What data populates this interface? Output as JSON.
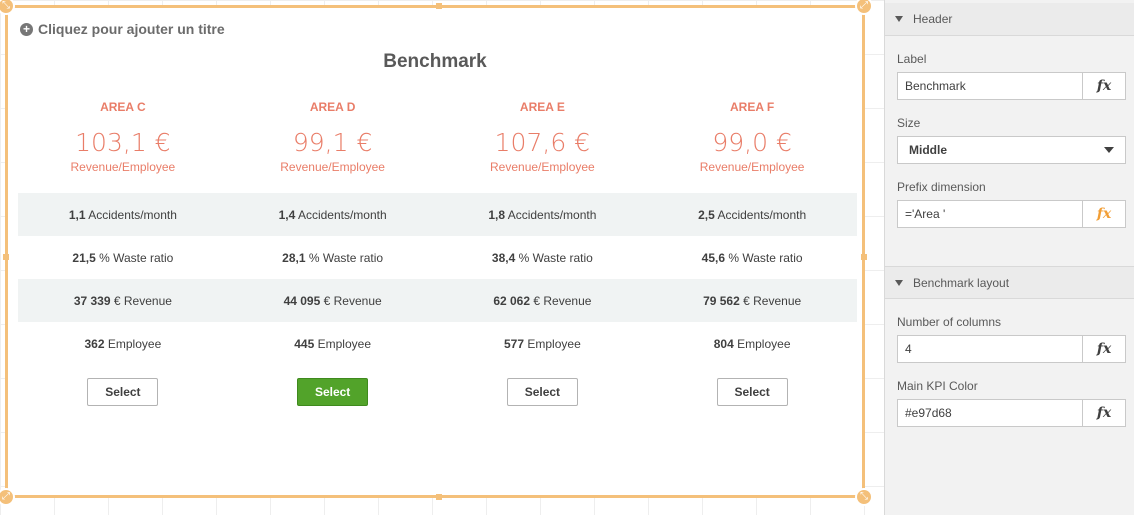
{
  "object": {
    "add_title": "Cliquez pour ajouter un titre",
    "benchmark_title": "Benchmark",
    "main_kpi_label": "Revenue/Employee",
    "areas": [
      {
        "name": "AREA C",
        "main_value": "103,1 €",
        "button": "Select",
        "selected": false
      },
      {
        "name": "AREA D",
        "main_value": "99,1 €",
        "button": "Select",
        "selected": true
      },
      {
        "name": "AREA E",
        "main_value": "107,6 €",
        "button": "Select",
        "selected": false
      },
      {
        "name": "AREA F",
        "main_value": "99,0 €",
        "button": "Select",
        "selected": false
      }
    ],
    "kpi_rows": [
      {
        "label": "Accidents/month",
        "values": [
          "1,1",
          "1,4",
          "1,8",
          "2,5"
        ]
      },
      {
        "label": "% Waste ratio",
        "values": [
          "21,5",
          "28,1",
          "38,4",
          "45,6"
        ]
      },
      {
        "label": "€ Revenue",
        "values": [
          "37 339",
          "44 095",
          "62 062",
          "79 562"
        ]
      },
      {
        "label": "Employee",
        "values": [
          "362",
          "445",
          "577",
          "804"
        ]
      }
    ]
  },
  "panel": {
    "header_section": "Header",
    "label_caption": "Label",
    "label_value": "Benchmark",
    "size_caption": "Size",
    "size_value": "Middle",
    "prefix_caption": "Prefix dimension",
    "prefix_value": "='Area '",
    "layout_section": "Benchmark layout",
    "columns_caption": "Number of columns",
    "columns_value": "4",
    "color_caption": "Main KPI Color",
    "color_value": "#e97d68",
    "fx": "fx"
  },
  "colors": {
    "kpi": "#e97d68",
    "selected_button": "#52a32a",
    "frame": "#f4c07a",
    "fx_active": "#f29e35"
  }
}
